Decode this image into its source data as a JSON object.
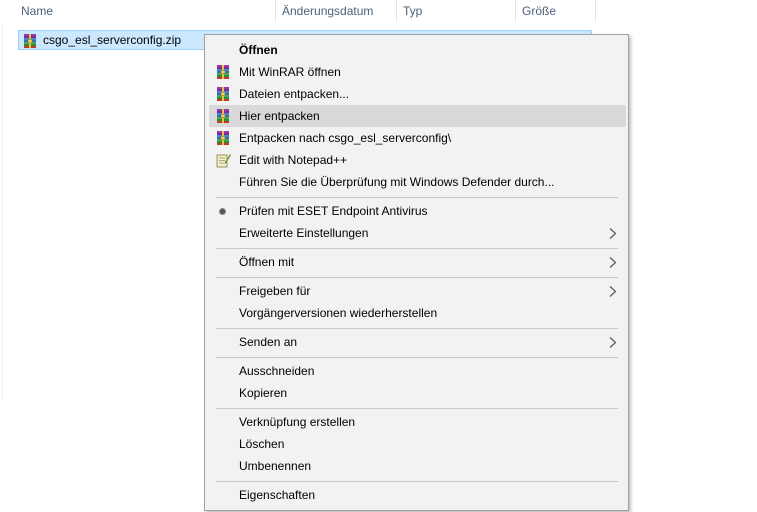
{
  "columns": {
    "name": "Name",
    "date": "Änderungsdatum",
    "type": "Typ",
    "size": "Größe"
  },
  "file": {
    "name": "csgo_esl_serverconfig.zip",
    "icon": "winrar-archive-icon"
  },
  "menu": {
    "items": [
      {
        "label": "Öffnen",
        "bold": true
      },
      {
        "label": "Mit WinRAR öffnen",
        "icon": "winrar-icon"
      },
      {
        "label": "Dateien entpacken...",
        "icon": "winrar-icon"
      },
      {
        "label": "Hier entpacken",
        "icon": "winrar-icon",
        "highlighted": true
      },
      {
        "label": "Entpacken nach csgo_esl_serverconfig\\",
        "icon": "winrar-icon"
      },
      {
        "label": "Edit with Notepad++",
        "icon": "notepadpp-icon"
      },
      {
        "label": "Führen Sie die Überprüfung mit Windows Defender durch..."
      },
      {
        "label": "Prüfen mit ESET Endpoint Antivirus",
        "icon": "eset-icon"
      },
      {
        "label": "Erweiterte Einstellungen",
        "submenu": true
      },
      {
        "label": "Öffnen mit",
        "submenu": true
      },
      {
        "label": "Freigeben für",
        "submenu": true
      },
      {
        "label": "Vorgängerversionen wiederherstellen"
      },
      {
        "label": "Senden an",
        "submenu": true
      },
      {
        "label": "Ausschneiden"
      },
      {
        "label": "Kopieren"
      },
      {
        "label": "Verknüpfung erstellen"
      },
      {
        "label": "Löschen"
      },
      {
        "label": "Umbenennen"
      },
      {
        "label": "Eigenschaften"
      }
    ]
  },
  "colors": {
    "selection_bg": "#cce8ff",
    "selection_border": "#99d1ff",
    "menu_bg": "#f2f2f2",
    "menu_highlight": "#d9d9d9"
  }
}
